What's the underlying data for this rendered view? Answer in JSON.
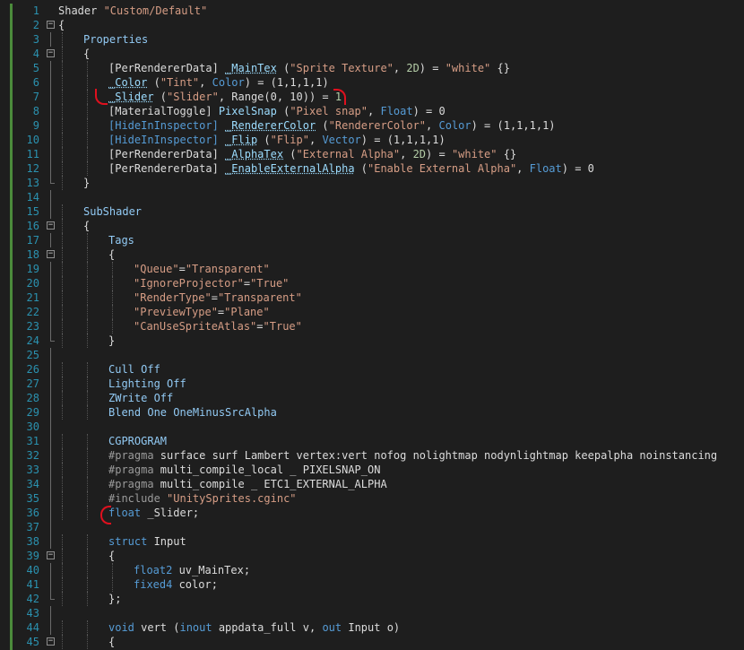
{
  "editor": {
    "first_line": 1,
    "lines": [
      [
        [
          "Shader ",
          ""
        ],
        [
          "\"Custom/Default\"",
          "str"
        ]
      ],
      [
        [
          "{",
          ""
        ]
      ],
      [
        [
          "Properties",
          "sec"
        ]
      ],
      [
        [
          "{",
          ""
        ]
      ],
      [
        [
          "[PerRendererData] ",
          ""
        ],
        [
          "_MainTex",
          "nm-ul"
        ],
        [
          " (",
          ""
        ],
        [
          "\"Sprite Texture\"",
          "str"
        ],
        [
          ", ",
          ""
        ],
        [
          "2D",
          "num"
        ],
        [
          ") = ",
          ""
        ],
        [
          "\"white\"",
          "str"
        ],
        [
          " {}",
          ""
        ]
      ],
      [
        [
          "_Color",
          "nm-ul"
        ],
        [
          " (",
          ""
        ],
        [
          "\"Tint\"",
          "str"
        ],
        [
          ", ",
          ""
        ],
        [
          "Color",
          "kw"
        ],
        [
          ") = (1,1,1,1)",
          ""
        ]
      ],
      [
        [
          "_Slider",
          "nm-ul"
        ],
        [
          " (",
          ""
        ],
        [
          "\"Slider\"",
          "str"
        ],
        [
          ", Range(0, 10)) = ",
          ""
        ],
        [
          "1",
          "num"
        ]
      ],
      [
        [
          "[MaterialToggle] ",
          ""
        ],
        [
          "PixelSnap",
          "nm"
        ],
        [
          " (",
          ""
        ],
        [
          "\"Pixel snap\"",
          "str"
        ],
        [
          ", ",
          ""
        ],
        [
          "Float",
          "kw"
        ],
        [
          ") = 0",
          ""
        ]
      ],
      [
        [
          "[HideInInspector] ",
          "attr"
        ],
        [
          "_RendererColor",
          "nm-ul"
        ],
        [
          " (",
          ""
        ],
        [
          "\"RendererColor\"",
          "str"
        ],
        [
          ", ",
          ""
        ],
        [
          "Color",
          "kw"
        ],
        [
          ") = (1,1,1,1)",
          ""
        ]
      ],
      [
        [
          "[HideInInspector] ",
          "attr"
        ],
        [
          "_Flip",
          "nm-ul"
        ],
        [
          " (",
          ""
        ],
        [
          "\"Flip\"",
          "str"
        ],
        [
          ", ",
          ""
        ],
        [
          "Vector",
          "kw"
        ],
        [
          ") = (1,1,1,1)",
          ""
        ]
      ],
      [
        [
          "[PerRendererData] ",
          ""
        ],
        [
          "_AlphaTex",
          "nm-ul"
        ],
        [
          " (",
          ""
        ],
        [
          "\"External Alpha\"",
          "str"
        ],
        [
          ", ",
          ""
        ],
        [
          "2D",
          "num"
        ],
        [
          ") = ",
          ""
        ],
        [
          "\"white\"",
          "str"
        ],
        [
          " {}",
          ""
        ]
      ],
      [
        [
          "[PerRendererData] ",
          ""
        ],
        [
          "_EnableExternalAlpha",
          "nm-ul"
        ],
        [
          " (",
          ""
        ],
        [
          "\"Enable External Alpha\"",
          "str"
        ],
        [
          ", ",
          ""
        ],
        [
          "Float",
          "kw"
        ],
        [
          ") = 0",
          ""
        ]
      ],
      [
        [
          "}",
          ""
        ]
      ],
      [],
      [
        [
          "SubShader",
          "sec"
        ]
      ],
      [
        [
          "{",
          ""
        ]
      ],
      [
        [
          "Tags",
          "sec"
        ]
      ],
      [
        [
          "{",
          ""
        ]
      ],
      [
        [
          "\"Queue\"",
          "str"
        ],
        [
          "=",
          ""
        ],
        [
          "\"Transparent\"",
          "str"
        ]
      ],
      [
        [
          "\"IgnoreProjector\"",
          "str"
        ],
        [
          "=",
          ""
        ],
        [
          "\"True\"",
          "str"
        ]
      ],
      [
        [
          "\"RenderType\"",
          "str"
        ],
        [
          "=",
          ""
        ],
        [
          "\"Transparent\"",
          "str"
        ]
      ],
      [
        [
          "\"PreviewType\"",
          "str"
        ],
        [
          "=",
          ""
        ],
        [
          "\"Plane\"",
          "str"
        ]
      ],
      [
        [
          "\"CanUseSpriteAtlas\"",
          "str"
        ],
        [
          "=",
          ""
        ],
        [
          "\"True\"",
          "str"
        ]
      ],
      [
        [
          "}",
          ""
        ]
      ],
      [],
      [
        [
          "Cull Off",
          "sec"
        ]
      ],
      [
        [
          "Lighting Off",
          "sec"
        ]
      ],
      [
        [
          "ZWrite Off",
          "sec"
        ]
      ],
      [
        [
          "Blend One OneMinusSrcAlpha",
          "sec"
        ]
      ],
      [],
      [
        [
          "CGPROGRAM",
          "sec"
        ]
      ],
      [
        [
          "#pragma",
          "pp"
        ],
        [
          " surface surf Lambert vertex:vert nofog nolightmap nodynlightmap keepalpha noinstancing",
          ""
        ]
      ],
      [
        [
          "#pragma",
          "pp"
        ],
        [
          " multi_compile_local _ PIXELSNAP_ON",
          ""
        ]
      ],
      [
        [
          "#pragma",
          "pp"
        ],
        [
          " multi_compile _ ETC1_EXTERNAL_ALPHA",
          ""
        ]
      ],
      [
        [
          "#include",
          "pp"
        ],
        [
          " ",
          ""
        ],
        [
          "\"UnitySprites.cginc\"",
          "str"
        ]
      ],
      [
        [
          "float",
          "kw"
        ],
        [
          " _Slider;",
          ""
        ]
      ],
      [],
      [
        [
          "struct",
          "kw"
        ],
        [
          " Input",
          ""
        ]
      ],
      [
        [
          "{",
          ""
        ]
      ],
      [
        [
          "float2",
          "kw"
        ],
        [
          " uv_MainTex;",
          ""
        ]
      ],
      [
        [
          "fixed4",
          "kw"
        ],
        [
          " color;",
          ""
        ]
      ],
      [
        [
          "};",
          ""
        ]
      ],
      [],
      [
        [
          "void",
          "kw"
        ],
        [
          " vert (",
          ""
        ],
        [
          "inout",
          "kw"
        ],
        [
          " appdata_full v, ",
          ""
        ],
        [
          "out",
          "kw"
        ],
        [
          " Input o)",
          ""
        ]
      ],
      [
        [
          "{",
          ""
        ]
      ]
    ]
  }
}
